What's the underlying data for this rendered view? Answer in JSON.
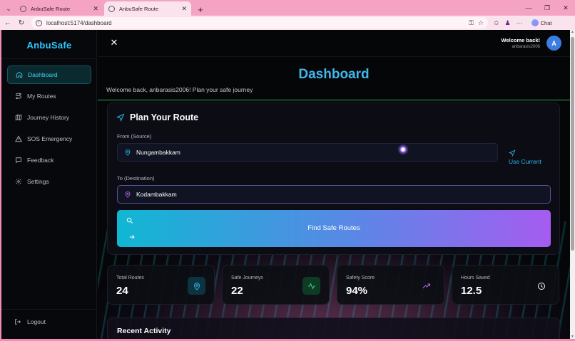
{
  "browser": {
    "tabs": [
      {
        "title": "AnbuSafe Route",
        "active": false
      },
      {
        "title": "AnbuSafe Route",
        "active": true
      }
    ],
    "url": "localhost:5174/dashboard",
    "chat_label": "Chat",
    "tab_bg": "#f4a3c3",
    "frame_color": "#ef8fb4"
  },
  "sidebar": {
    "brand": "AnbuSafe",
    "items": [
      {
        "label": "Dashboard",
        "icon": "home-icon",
        "active": true
      },
      {
        "label": "My Routes",
        "icon": "route-icon",
        "active": false
      },
      {
        "label": "Journey History",
        "icon": "map-icon",
        "active": false
      },
      {
        "label": "SOS Emergency",
        "icon": "alert-triangle-icon",
        "active": false
      },
      {
        "label": "Feedback",
        "icon": "message-icon",
        "active": false
      },
      {
        "label": "Settings",
        "icon": "gear-icon",
        "active": false
      }
    ],
    "logout_label": "Logout"
  },
  "header": {
    "welcome_title": "Welcome back!",
    "username": "anbarasis2006",
    "avatar_letter": "A"
  },
  "main": {
    "title": "Dashboard",
    "subtitle": "Welcome back, anbarasis2006! Plan your safe journey"
  },
  "plan": {
    "title": "Plan Your Route",
    "from_label": "From (Source)",
    "from_value": "Nungambakkam",
    "use_current_label": "Use Current",
    "to_label": "To (Destination)",
    "to_value": "Kodambakkam",
    "find_label": "Find Safe Routes"
  },
  "stats": [
    {
      "label": "Total Routes",
      "value": "24",
      "icon": "map-pin-icon",
      "icon_color": "#2bb5e8",
      "icon_bg": "#0e3340"
    },
    {
      "label": "Safe Journeys",
      "value": "22",
      "icon": "activity-icon",
      "icon_color": "#39d27a",
      "icon_bg": "#0f3a24"
    },
    {
      "label": "Safety Score",
      "value": "94%",
      "icon": "trending-up-icon",
      "icon_color": "#b36bf5",
      "icon_bg": "transparent"
    },
    {
      "label": "Hours Saved",
      "value": "12.5",
      "icon": "clock-icon",
      "icon_color": "#ffffff",
      "icon_bg": "transparent"
    }
  ],
  "recent": {
    "title": "Recent Activity"
  },
  "colors": {
    "accent": "#2ac9ff",
    "active_nav_bg": "#0b2a30",
    "button_gradient_start": "#10b7d3",
    "button_gradient_end": "#a55cf0"
  }
}
